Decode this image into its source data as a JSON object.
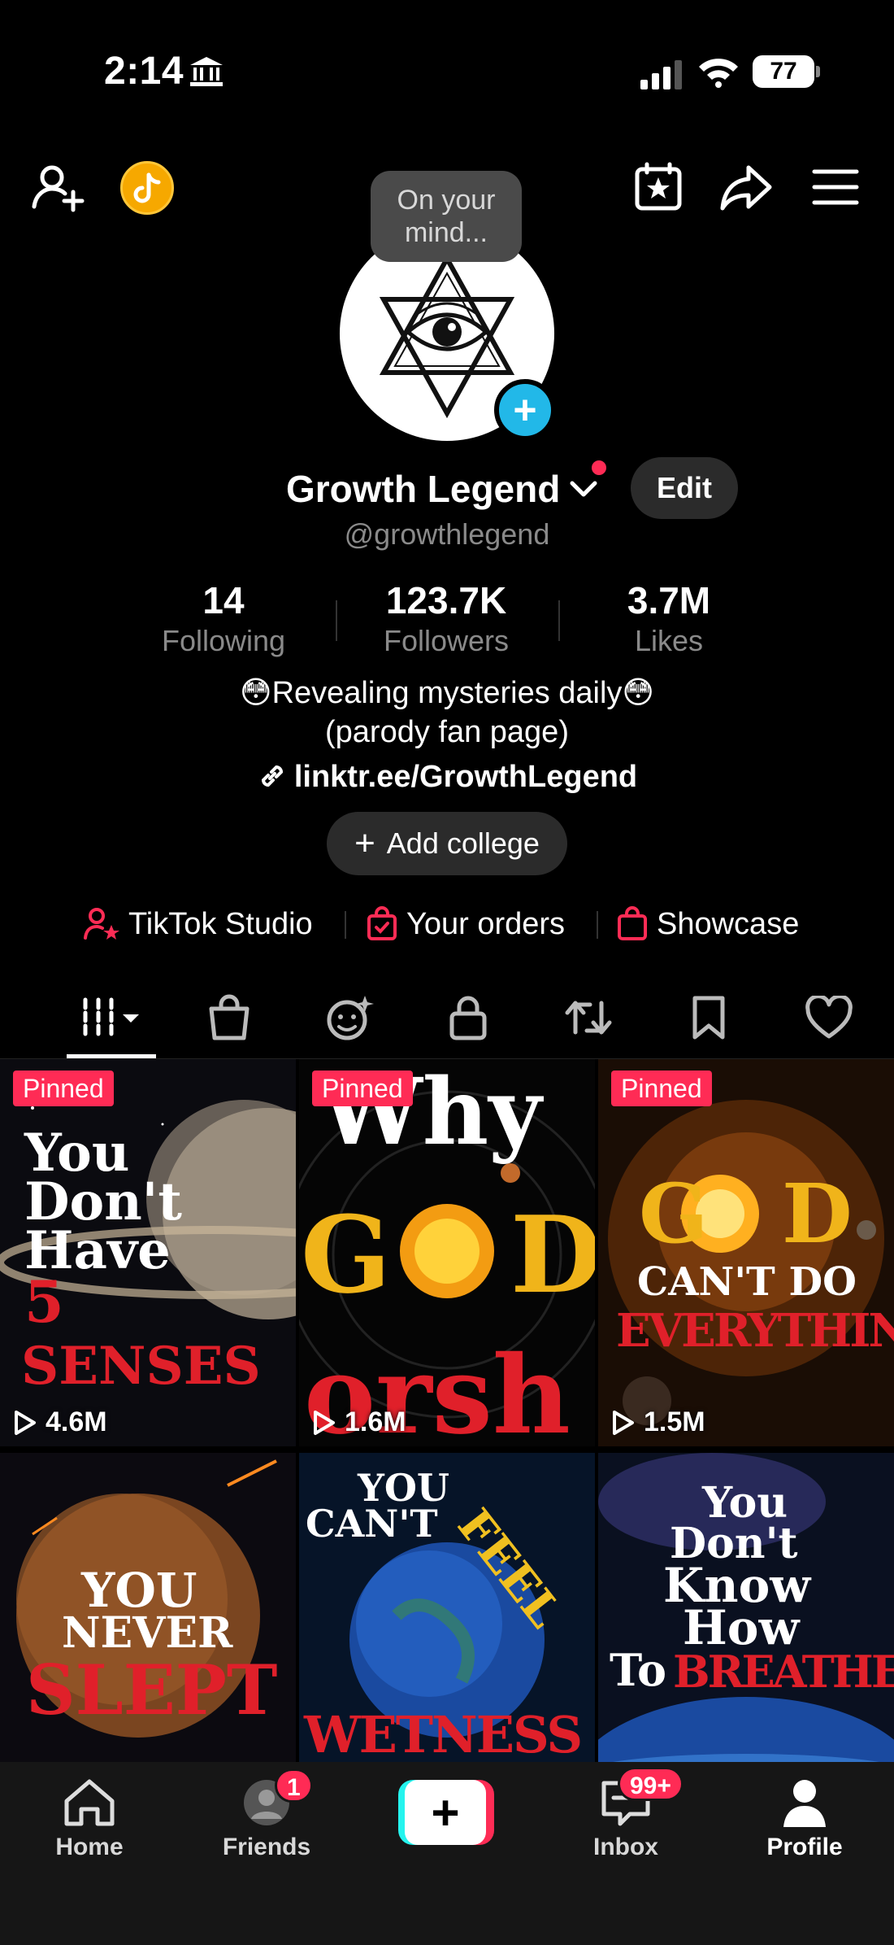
{
  "status_bar": {
    "time": "2:14",
    "battery": "77"
  },
  "avatar": {
    "thought_bubble": "On your mind..."
  },
  "profile": {
    "name": "Growth Legend",
    "edit_label": "Edit",
    "handle": "@growthlegend",
    "stats": [
      {
        "value": "14",
        "label": "Following"
      },
      {
        "value": "123.7K",
        "label": "Followers"
      },
      {
        "value": "3.7M",
        "label": "Likes"
      }
    ],
    "bio_line1": "😳Revealing mysteries daily😳",
    "bio_line2": "(parody fan page)",
    "link": "linktr.ee/GrowthLegend",
    "add_college_label": "Add college"
  },
  "shortcuts": [
    {
      "label": "TikTok Studio",
      "icon": "studio-person-star-icon"
    },
    {
      "label": "Your orders",
      "icon": "orders-bag-check-icon"
    },
    {
      "label": "Showcase",
      "icon": "showcase-bag-icon"
    }
  ],
  "tabs": [
    {
      "name": "videos-grid",
      "icon": "grid-bars-icon",
      "active": true
    },
    {
      "name": "shop",
      "icon": "shopping-bag-icon"
    },
    {
      "name": "collab",
      "icon": "face-sparkle-icon"
    },
    {
      "name": "private",
      "icon": "lock-icon"
    },
    {
      "name": "reposts",
      "icon": "repost-icon"
    },
    {
      "name": "favorites",
      "icon": "bookmark-icon"
    },
    {
      "name": "liked",
      "icon": "heart-icon"
    }
  ],
  "videos": [
    {
      "pinned_label": "Pinned",
      "views": "4.6M",
      "title": "You Don't Have 5 SENSES"
    },
    {
      "pinned_label": "Pinned",
      "views": "1.6M",
      "title": "Why GOD orsh"
    },
    {
      "pinned_label": "Pinned",
      "views": "1.5M",
      "title": "GOD CAN'T DO EVERYTHING"
    },
    {
      "pinned_label": "",
      "views": "",
      "title": "YOU NEVER SLEPT"
    },
    {
      "pinned_label": "",
      "views": "",
      "title": "YOU CAN'T FEEL WETNESS"
    },
    {
      "pinned_label": "",
      "views": "",
      "title": "You Don't Know How To BREATHE"
    }
  ],
  "tile_text": {
    "t1a": "You",
    "t1b": "Don't",
    "t1c": "Have",
    "t1d": "5",
    "t1e": "SENSES",
    "t2a": "Why",
    "t2b": "G",
    "t2c": "D",
    "t2d": "orsh",
    "t3a": "G",
    "t3b": "D",
    "t3c": "CAN'T DO",
    "t3d": "EVERYTHING",
    "t4a": "YOU",
    "t4b": "NEVER",
    "t4c": "SLEPT",
    "t5a": "YOU",
    "t5b": "CAN'T",
    "t5c": "FEEL",
    "t5d": "WETNESS",
    "t6a": "You",
    "t6b": "Don't",
    "t6c": "Know",
    "t6d": "How",
    "t6e": "To",
    "t6f": "BREATHE"
  },
  "bottom_nav": [
    {
      "label": "Home"
    },
    {
      "label": "Friends",
      "badge": "1"
    },
    {
      "label": "",
      "icon": "create-plus-icon"
    },
    {
      "label": "Inbox",
      "badge": "99+"
    },
    {
      "label": "Profile",
      "active": true
    }
  ],
  "colors": {
    "accent": "#fe2c55",
    "cyan": "#25f4ee",
    "background": "#000000",
    "muted": "#8a8a8a"
  }
}
